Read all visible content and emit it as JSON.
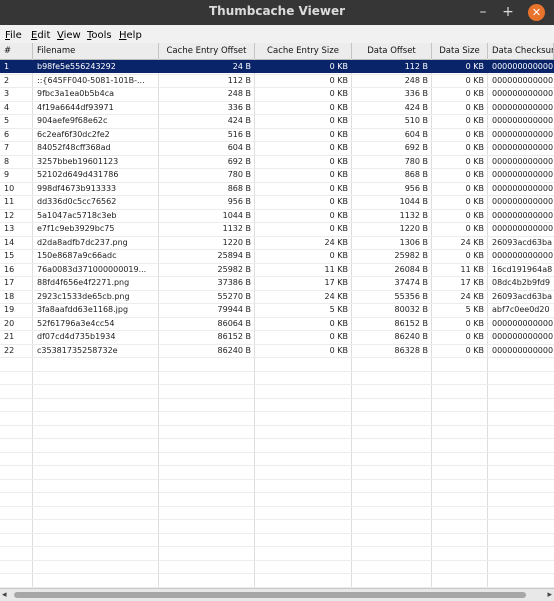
{
  "window": {
    "title": "Thumbcache Viewer",
    "minimize_glyph": "–",
    "maximize_glyph": "+",
    "close_glyph": "✕"
  },
  "menu": [
    {
      "label": "File",
      "mnemonic": "F"
    },
    {
      "label": "Edit",
      "mnemonic": "E"
    },
    {
      "label": "View",
      "mnemonic": "V"
    },
    {
      "label": "Tools",
      "mnemonic": "T"
    },
    {
      "label": "Help",
      "mnemonic": "H"
    }
  ],
  "columns": [
    "#",
    "Filename",
    "Cache Entry Offset",
    "Cache Entry Size",
    "Data Offset",
    "Data Size",
    "Data Checksum"
  ],
  "selected_row": 0,
  "rows": [
    [
      "1",
      "b98fe5e556243292",
      "24 B",
      "0 KB",
      "112 B",
      "0 KB",
      "000000000000"
    ],
    [
      "2",
      "::{645FF040-5081-101B-...",
      "112 B",
      "0 KB",
      "248 B",
      "0 KB",
      "000000000000"
    ],
    [
      "3",
      "9fbc3a1ea0b5b4ca",
      "248 B",
      "0 KB",
      "336 B",
      "0 KB",
      "000000000000"
    ],
    [
      "4",
      "4f19a6644df93971",
      "336 B",
      "0 KB",
      "424 B",
      "0 KB",
      "000000000000"
    ],
    [
      "5",
      "904aefe9f68e62c",
      "424 B",
      "0 KB",
      "510 B",
      "0 KB",
      "000000000000"
    ],
    [
      "6",
      "6c2eaf6f30dc2fe2",
      "516 B",
      "0 KB",
      "604 B",
      "0 KB",
      "000000000000"
    ],
    [
      "7",
      "84052f48cff368ad",
      "604 B",
      "0 KB",
      "692 B",
      "0 KB",
      "000000000000"
    ],
    [
      "8",
      "3257bbeb19601123",
      "692 B",
      "0 KB",
      "780 B",
      "0 KB",
      "000000000000"
    ],
    [
      "9",
      "52102d649d431786",
      "780 B",
      "0 KB",
      "868 B",
      "0 KB",
      "000000000000"
    ],
    [
      "10",
      "998df4673b913333",
      "868 B",
      "0 KB",
      "956 B",
      "0 KB",
      "000000000000"
    ],
    [
      "11",
      "dd336d0c5cc76562",
      "956 B",
      "0 KB",
      "1044 B",
      "0 KB",
      "000000000000"
    ],
    [
      "12",
      "5a1047ac5718c3eb",
      "1044 B",
      "0 KB",
      "1132 B",
      "0 KB",
      "000000000000"
    ],
    [
      "13",
      "e7f1c9eb3929bc75",
      "1132 B",
      "0 KB",
      "1220 B",
      "0 KB",
      "000000000000"
    ],
    [
      "14",
      "d2da8adfb7dc237.png",
      "1220 B",
      "24 KB",
      "1306 B",
      "24 KB",
      "26093acd63ba"
    ],
    [
      "15",
      "150e8687a9c66adc",
      "25894 B",
      "0 KB",
      "25982 B",
      "0 KB",
      "000000000000"
    ],
    [
      "16",
      "76a0083d371000000019...",
      "25982 B",
      "11 KB",
      "26084 B",
      "11 KB",
      "16cd191964a8"
    ],
    [
      "17",
      "88fd4f656e4f2271.png",
      "37386 B",
      "17 KB",
      "37474 B",
      "17 KB",
      "08dc4b2b9fd9"
    ],
    [
      "18",
      "2923c1533de65cb.png",
      "55270 B",
      "24 KB",
      "55356 B",
      "24 KB",
      "26093acd63ba"
    ],
    [
      "19",
      "3fa8aafdd63e1168.jpg",
      "79944 B",
      "5 KB",
      "80032 B",
      "5 KB",
      "abf7c0ee0d20"
    ],
    [
      "20",
      "52f61796a3e4cc54",
      "86064 B",
      "0 KB",
      "86152 B",
      "0 KB",
      "000000000000"
    ],
    [
      "21",
      "df07cd4d735b1934",
      "86152 B",
      "0 KB",
      "86240 B",
      "0 KB",
      "000000000000"
    ],
    [
      "22",
      "c35381735258732e",
      "86240 B",
      "0 KB",
      "86328 B",
      "0 KB",
      "000000000000"
    ]
  ],
  "icons": {
    "scroll_left": "◂",
    "scroll_right": "▸"
  }
}
